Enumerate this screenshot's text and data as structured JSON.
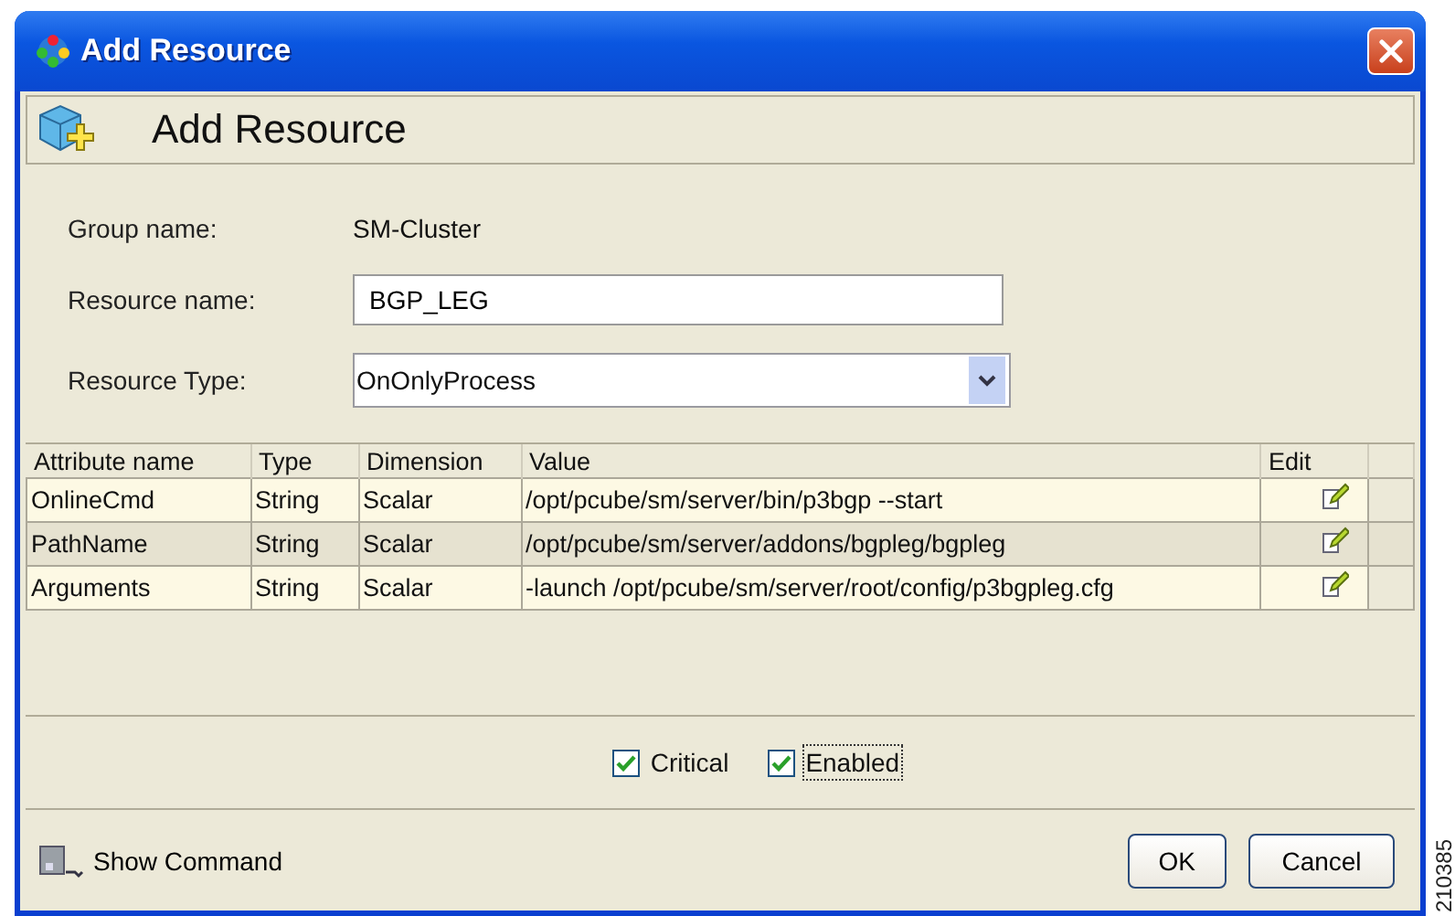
{
  "window": {
    "title": "Add Resource"
  },
  "header": {
    "title": "Add Resource"
  },
  "form": {
    "group_name": {
      "label": "Group name:",
      "value": "SM-Cluster"
    },
    "resource_name": {
      "label": "Resource name:",
      "value": "BGP_LEG"
    },
    "resource_type": {
      "label": "Resource Type:",
      "value": "OnOnlyProcess"
    }
  },
  "table": {
    "columns": [
      "Attribute name",
      "Type",
      "Dimension",
      "Value",
      "Edit"
    ],
    "rows": [
      {
        "cells": [
          "OnlineCmd",
          "String",
          "Scalar",
          "/opt/pcube/sm/server/bin/p3bgp --start"
        ]
      },
      {
        "cells": [
          "PathName",
          "String",
          "Scalar",
          "/opt/pcube/sm/server/addons/bgpleg/bgpleg"
        ]
      },
      {
        "cells": [
          "Arguments",
          "String",
          "Scalar",
          "-launch /opt/pcube/sm/server/root/config/p3bgpleg.cfg"
        ]
      }
    ]
  },
  "checkboxes": [
    {
      "label": "Critical",
      "checked": true,
      "focused": false
    },
    {
      "label": "Enabled",
      "checked": true,
      "focused": true
    }
  ],
  "show_command": {
    "label": "Show Command"
  },
  "buttons": [
    "OK",
    "Cancel"
  ],
  "figure_number": "210385"
}
